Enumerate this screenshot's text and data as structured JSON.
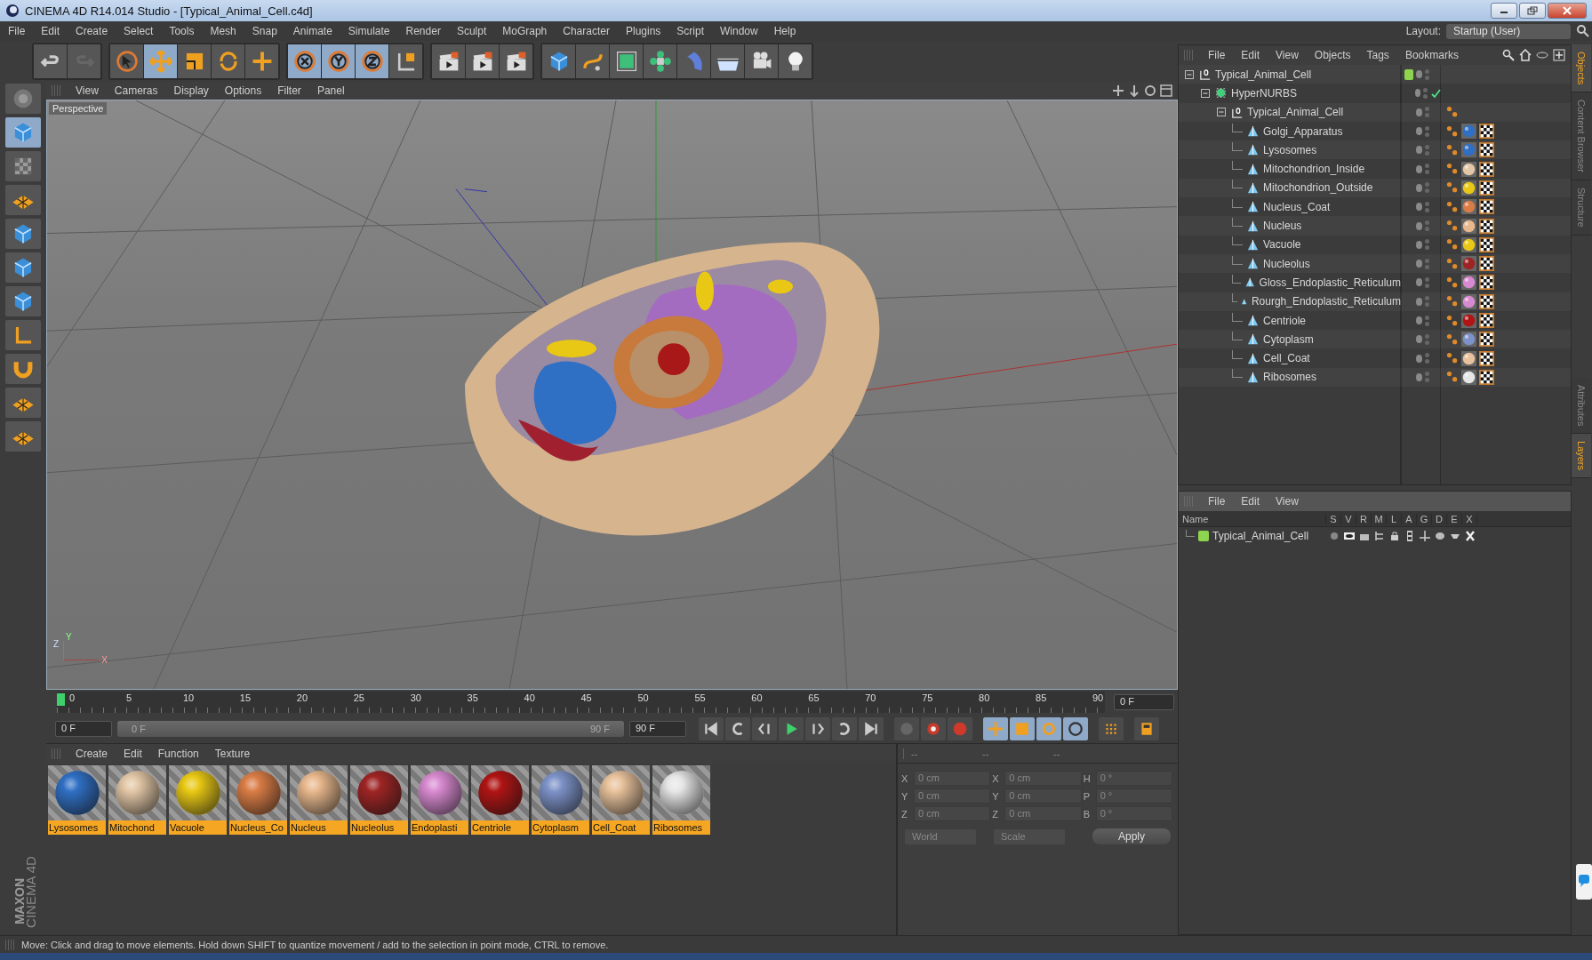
{
  "window": {
    "title": "CINEMA 4D R14.014 Studio - [Typical_Animal_Cell.c4d]"
  },
  "menu": [
    "File",
    "Edit",
    "Create",
    "Select",
    "Tools",
    "Mesh",
    "Snap",
    "Animate",
    "Simulate",
    "Render",
    "Sculpt",
    "MoGraph",
    "Character",
    "Plugins",
    "Script",
    "Window",
    "Help"
  ],
  "layout": {
    "label": "Layout:",
    "value": "Startup (User)"
  },
  "toolbar": [
    {
      "kind": "undo",
      "selected": false
    },
    {
      "kind": "redo",
      "selected": false
    },
    {
      "kind": "select",
      "selected": false
    },
    {
      "kind": "move",
      "selected": true
    },
    {
      "kind": "scale",
      "selected": false
    },
    {
      "kind": "rotate",
      "selected": false
    },
    {
      "kind": "add",
      "selected": false
    },
    {
      "kind": "x",
      "selected": true
    },
    {
      "kind": "y",
      "selected": true
    },
    {
      "kind": "z",
      "selected": true
    },
    {
      "kind": "coord",
      "selected": false
    },
    {
      "kind": "render",
      "selected": false
    },
    {
      "kind": "render",
      "selected": false
    },
    {
      "kind": "render",
      "selected": false
    },
    {
      "kind": "cube",
      "selected": false
    },
    {
      "kind": "spline",
      "selected": false
    },
    {
      "kind": "nurbs",
      "selected": false
    },
    {
      "kind": "array",
      "selected": false
    },
    {
      "kind": "deformer",
      "selected": false
    },
    {
      "kind": "floor",
      "selected": false
    },
    {
      "kind": "camera",
      "selected": false
    },
    {
      "kind": "light",
      "selected": false
    }
  ],
  "side_tools": [
    {
      "kind": "mode",
      "selected": false
    },
    {
      "kind": "cube",
      "selected": true
    },
    {
      "kind": "checker",
      "selected": false
    },
    {
      "kind": "grid",
      "selected": false
    },
    {
      "kind": "cube",
      "selected": false
    },
    {
      "kind": "cube",
      "selected": false
    },
    {
      "kind": "cube",
      "selected": false
    },
    {
      "kind": "axis",
      "selected": false
    },
    {
      "kind": "magnet",
      "selected": false
    },
    {
      "kind": "grid",
      "selected": false
    },
    {
      "kind": "grid",
      "selected": false
    }
  ],
  "viewport": {
    "menu": [
      "View",
      "Cameras",
      "Display",
      "Options",
      "Filter",
      "Panel"
    ],
    "camera": "Perspective",
    "axis_labels": [
      "Y",
      "Z",
      "X"
    ]
  },
  "timeline": {
    "ticks": [
      "0",
      "5",
      "10",
      "15",
      "20",
      "25",
      "30",
      "35",
      "40",
      "45",
      "50",
      "55",
      "60",
      "65",
      "70",
      "75",
      "80",
      "85",
      "90"
    ],
    "playhead": {
      "level": 0
    },
    "frame_end_display": "0 F",
    "current": "0 F",
    "range": {
      "start": "0 F",
      "end": "90 F",
      "level": 1
    },
    "end": "90 F"
  },
  "material_manager": {
    "menu": [
      "Create",
      "Edit",
      "Function",
      "Texture"
    ],
    "materials": [
      {
        "name": "Lysosomes",
        "color": "#2f6fc4"
      },
      {
        "name": "Mitochond",
        "color": "#e2c7a6"
      },
      {
        "name": "Vacuole",
        "color": "#e8c814"
      },
      {
        "name": "Nucleus_Co",
        "color": "#d97c45"
      },
      {
        "name": "Nucleus",
        "color": "#e8b88d"
      },
      {
        "name": "Nucleolus",
        "color": "#9e2424"
      },
      {
        "name": "Endoplasti",
        "color": "#d88ad0"
      },
      {
        "name": "Centriole",
        "color": "#b01414"
      },
      {
        "name": "Cytoplasm",
        "color": "#7d92c8"
      },
      {
        "name": "Cell_Coat",
        "color": "#e8c29c"
      },
      {
        "name": "Ribosomes",
        "color": "#e6e6e6"
      }
    ]
  },
  "coordinates": {
    "headers": [
      "--",
      "--",
      "--"
    ],
    "columns": [
      [
        {
          "label": "X",
          "value": "0 cm"
        },
        {
          "label": "Y",
          "value": "0 cm"
        },
        {
          "label": "Z",
          "value": "0 cm"
        }
      ],
      [
        {
          "label": "X",
          "value": "0 cm"
        },
        {
          "label": "Y",
          "value": "0 cm"
        },
        {
          "label": "Z",
          "value": "0 cm"
        }
      ],
      [
        {
          "label": "H",
          "value": "0 °"
        },
        {
          "label": "P",
          "value": "0 °"
        },
        {
          "label": "B",
          "value": "0 °"
        }
      ]
    ],
    "dropdowns": [
      "World",
      "Scale"
    ],
    "apply": "Apply"
  },
  "object_manager": {
    "menu": [
      "File",
      "Edit",
      "View",
      "Objects",
      "Tags",
      "Bookmarks"
    ],
    "objects": [
      {
        "name": "Typical_Animal_Cell",
        "kind": "null",
        "color": "#8fd44e",
        "expanded": true,
        "children": [
          {
            "name": "HyperNURBS",
            "kind": "hypernurbs",
            "expanded": true,
            "children": [
              {
                "name": "Typical_Animal_Cell",
                "kind": "null",
                "expanded": true,
                "tags": [
                  {
                    "kind": "phong"
                  }
                ],
                "children": [
                  {
                    "name": "Golgi_Apparatus",
                    "kind": "polygon",
                    "color": "#2f6fc4",
                    "tags": [
                      {
                        "kind": "phong"
                      },
                      {
                        "kind": "material"
                      },
                      {
                        "kind": "texture"
                      }
                    ]
                  },
                  {
                    "name": "Lysosomes",
                    "kind": "polygon",
                    "color": "#2f6fc4",
                    "tags": [
                      {
                        "kind": "phong"
                      },
                      {
                        "kind": "material"
                      },
                      {
                        "kind": "texture"
                      }
                    ]
                  },
                  {
                    "name": "Mitochondrion_Inside",
                    "kind": "polygon",
                    "color": "#e2c7a6",
                    "tags": [
                      {
                        "kind": "phong"
                      },
                      {
                        "kind": "material"
                      },
                      {
                        "kind": "texture"
                      }
                    ]
                  },
                  {
                    "name": "Mitochondrion_Outside",
                    "kind": "polygon",
                    "color": "#e8c814",
                    "tags": [
                      {
                        "kind": "phong"
                      },
                      {
                        "kind": "material"
                      },
                      {
                        "kind": "texture"
                      }
                    ]
                  },
                  {
                    "name": "Nucleus_Coat",
                    "kind": "polygon",
                    "color": "#d97c45",
                    "tags": [
                      {
                        "kind": "phong"
                      },
                      {
                        "kind": "material"
                      },
                      {
                        "kind": "texture"
                      }
                    ]
                  },
                  {
                    "name": "Nucleus",
                    "kind": "polygon",
                    "color": "#e8b88d",
                    "tags": [
                      {
                        "kind": "phong"
                      },
                      {
                        "kind": "material"
                      },
                      {
                        "kind": "texture"
                      }
                    ]
                  },
                  {
                    "name": "Vacuole",
                    "kind": "polygon",
                    "color": "#e8c814",
                    "tags": [
                      {
                        "kind": "phong"
                      },
                      {
                        "kind": "material"
                      },
                      {
                        "kind": "texture"
                      }
                    ]
                  },
                  {
                    "name": "Nucleolus",
                    "kind": "polygon",
                    "color": "#9e2424",
                    "tags": [
                      {
                        "kind": "phong"
                      },
                      {
                        "kind": "material"
                      },
                      {
                        "kind": "texture"
                      }
                    ]
                  },
                  {
                    "name": "Gloss_Endoplastic_Reticulum",
                    "kind": "polygon",
                    "color": "#d88ad0",
                    "tags": [
                      {
                        "kind": "phong"
                      },
                      {
                        "kind": "material"
                      },
                      {
                        "kind": "texture"
                      }
                    ]
                  },
                  {
                    "name": "Rourgh_Endoplastic_Reticulum",
                    "kind": "polygon",
                    "color": "#d88ad0",
                    "tags": [
                      {
                        "kind": "phong"
                      },
                      {
                        "kind": "material"
                      },
                      {
                        "kind": "texture"
                      }
                    ]
                  },
                  {
                    "name": "Centriole",
                    "kind": "polygon",
                    "color": "#b01414",
                    "tags": [
                      {
                        "kind": "phong"
                      },
                      {
                        "kind": "material"
                      },
                      {
                        "kind": "texture"
                      }
                    ]
                  },
                  {
                    "name": "Cytoplasm",
                    "kind": "polygon",
                    "color": "#7d92c8",
                    "tags": [
                      {
                        "kind": "phong"
                      },
                      {
                        "kind": "material"
                      },
                      {
                        "kind": "texture"
                      }
                    ]
                  },
                  {
                    "name": "Cell_Coat",
                    "kind": "polygon",
                    "color": "#e8c29c",
                    "tags": [
                      {
                        "kind": "phong"
                      },
                      {
                        "kind": "material"
                      },
                      {
                        "kind": "texture"
                      }
                    ]
                  },
                  {
                    "name": "Ribosomes",
                    "kind": "polygon",
                    "color": "#e6e6e6",
                    "tags": [
                      {
                        "kind": "phong"
                      },
                      {
                        "kind": "material"
                      },
                      {
                        "kind": "texture"
                      }
                    ]
                  }
                ]
              }
            ]
          }
        ]
      }
    ]
  },
  "layer_manager": {
    "menu": [
      "File",
      "Edit",
      "View"
    ],
    "columns": [
      "Name",
      "S",
      "V",
      "R",
      "M",
      "L",
      "A",
      "G",
      "D",
      "E",
      "X"
    ],
    "layers": [
      {
        "name": "Typical_Animal_Cell",
        "color": "#8fd44e"
      }
    ]
  },
  "side_tabs_top": [
    {
      "label": "Objects",
      "selected": true
    },
    {
      "label": "Content Browser",
      "selected": false
    },
    {
      "label": "Structure",
      "selected": false
    }
  ],
  "side_tabs_bottom": [
    {
      "label": "Attributes",
      "selected": false
    },
    {
      "label": "Layers",
      "selected": true
    }
  ],
  "logo": {
    "brand": "MAXON",
    "product": "CINEMA 4D"
  },
  "status_bar": "Move: Click and drag to move elements. Hold down SHIFT to quantize movement / add to the selection in point mode, CTRL to remove."
}
